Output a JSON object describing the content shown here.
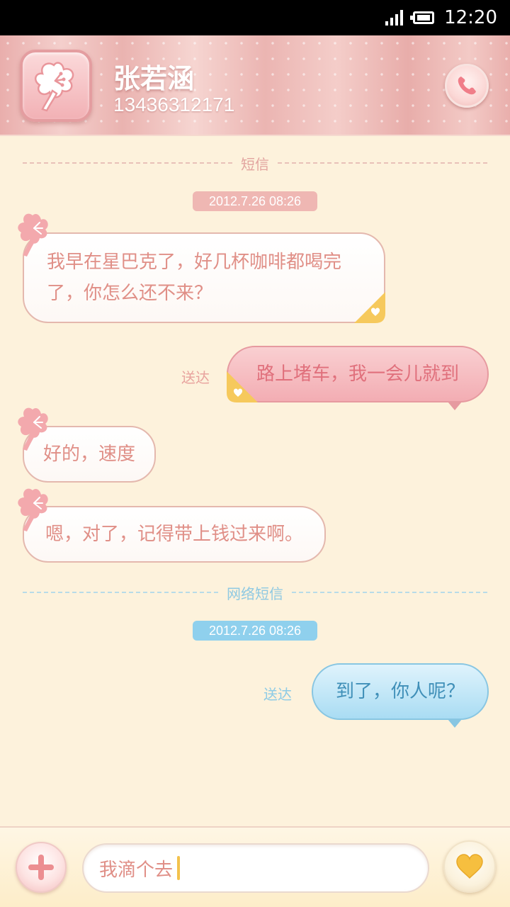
{
  "status_bar": {
    "time": "12:20"
  },
  "header": {
    "contact_name": "张若涵",
    "contact_number": "13436312171"
  },
  "sections": [
    {
      "label": "短信",
      "timestamp": "2012.7.26  08:26"
    },
    {
      "label": "网络短信",
      "timestamp": "2012.7.26  08:26"
    }
  ],
  "messages": [
    {
      "direction": "incoming",
      "text_line1": "我早在星巴克了，好几杯咖啡都喝完",
      "text_line2": "了，你怎么还不来？"
    },
    {
      "direction": "outgoing",
      "text": "路上堵车，我一会儿就到",
      "status": "送达"
    },
    {
      "direction": "incoming",
      "text": "好的，速度"
    },
    {
      "direction": "incoming",
      "text": "嗯，对了，记得带上钱过来啊。"
    },
    {
      "direction": "outgoing",
      "text": "到了，你人呢？",
      "status": "送达"
    }
  ],
  "composer": {
    "input_value": "我滴个去"
  },
  "colors": {
    "header_pink": "#efbcb8",
    "background": "#fdf2dc",
    "incoming_text": "#e08f87",
    "outgoing_pink": "#f3adb3",
    "outgoing_blue": "#a9dcf3"
  },
  "icons": {
    "avatar": "flower-icon",
    "call": "phone-icon",
    "add": "plus-icon",
    "send": "heart-icon"
  }
}
